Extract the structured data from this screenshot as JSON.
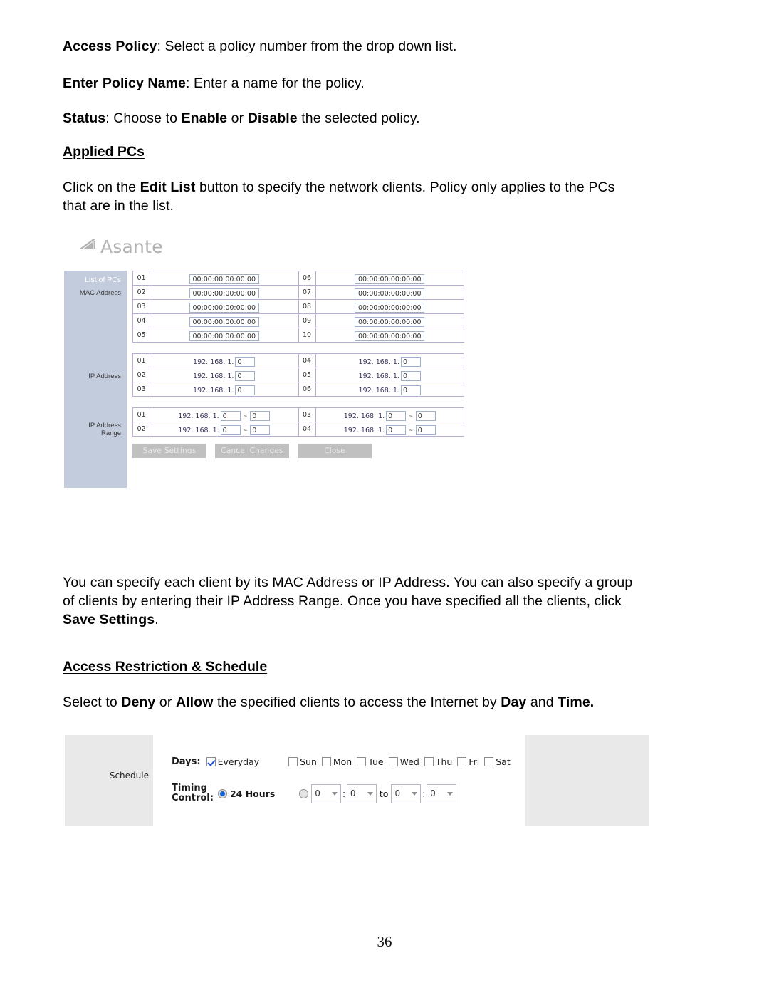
{
  "page": {
    "number": "36"
  },
  "body": {
    "para_access_policy": {
      "term": "Access Policy",
      "rest": ": Select a policy number from the drop down list."
    },
    "para_policy_name": {
      "term": "Enter Policy Name",
      "rest": ": Enter a name for the policy."
    },
    "para_status": {
      "term": "Status",
      "mid": ": Choose to ",
      "enable": "Enable",
      "or": " or ",
      "disable": "Disable",
      "end": " the selected policy."
    },
    "heading_applied_pcs": "Applied PCs",
    "para_edit_list": {
      "pre": "Click on the ",
      "term": "Edit List",
      "rest": " button to specify the network clients. Policy only applies to the PCs that are in the list."
    },
    "para_specify_clients": {
      "pre": "You can specify each client by its MAC Address or IP Address. You can also specify a group of clients by entering their IP Address Range. Once you have specified all the clients, click ",
      "term": "Save Settings",
      "end": "."
    },
    "heading_access_restriction": "Access Restriction & Schedule",
    "para_deny_allow": {
      "pre": "Select to ",
      "deny": "Deny",
      "or": " or ",
      "allow": "Allow",
      "mid": " the specified clients to access the Internet by ",
      "day": "Day",
      "and": " and ",
      "time": "Time."
    }
  },
  "screenshot_pcs": {
    "brand": "Asante",
    "sidebar": {
      "title": "List of PCs",
      "label_mac": "MAC Address",
      "label_ip": "IP Address",
      "label_ip_range": "IP Address Range"
    },
    "mac_table": {
      "left": [
        {
          "index": "01",
          "value": "00:00:00:00:00:00"
        },
        {
          "index": "02",
          "value": "00:00:00:00:00:00"
        },
        {
          "index": "03",
          "value": "00:00:00:00:00:00"
        },
        {
          "index": "04",
          "value": "00:00:00:00:00:00"
        },
        {
          "index": "05",
          "value": "00:00:00:00:00:00"
        }
      ],
      "right": [
        {
          "index": "06",
          "value": "00:00:00:00:00:00"
        },
        {
          "index": "07",
          "value": "00:00:00:00:00:00"
        },
        {
          "index": "08",
          "value": "00:00:00:00:00:00"
        },
        {
          "index": "09",
          "value": "00:00:00:00:00:00"
        },
        {
          "index": "10",
          "value": "00:00:00:00:00:00"
        }
      ]
    },
    "ip_table": {
      "prefix": "192. 168. 1.",
      "left": [
        {
          "index": "01",
          "octet": "0"
        },
        {
          "index": "02",
          "octet": "0"
        },
        {
          "index": "03",
          "octet": "0"
        }
      ],
      "right": [
        {
          "index": "04",
          "octet": "0"
        },
        {
          "index": "05",
          "octet": "0"
        },
        {
          "index": "06",
          "octet": "0"
        }
      ]
    },
    "ip_range_table": {
      "prefix": "192. 168. 1.",
      "separator": "~",
      "left": [
        {
          "index": "01",
          "from": "0",
          "to": "0"
        },
        {
          "index": "02",
          "from": "0",
          "to": "0"
        }
      ],
      "right": [
        {
          "index": "03",
          "from": "0",
          "to": "0"
        },
        {
          "index": "04",
          "from": "0",
          "to": "0"
        }
      ]
    },
    "buttons": {
      "save": "Save Settings",
      "cancel": "Cancel Changes",
      "close": "Close"
    }
  },
  "screenshot_schedule": {
    "panel_label": "Schedule",
    "days_label": "Days:",
    "everyday": {
      "label": "Everyday",
      "checked": true
    },
    "weekdays": [
      {
        "label": "Sun",
        "checked": false
      },
      {
        "label": "Mon",
        "checked": false
      },
      {
        "label": "Tue",
        "checked": false
      },
      {
        "label": "Wed",
        "checked": false
      },
      {
        "label": "Thu",
        "checked": false
      },
      {
        "label": "Fri",
        "checked": false
      },
      {
        "label": "Sat",
        "checked": false
      }
    ],
    "timing_label_line1": "Timing",
    "timing_label_line2": "Control:",
    "radio_24h": {
      "label": "24 Hours",
      "selected": true
    },
    "radio_range": {
      "label": "",
      "selected": false
    },
    "time_from_hour": "0",
    "time_from_min": "0",
    "time_to_hour": "0",
    "time_to_min": "0",
    "colon": ":",
    "to_label": "to"
  },
  "colors": {
    "sidebar_bg": "#c3ccdd",
    "panel_gray": "#e9e9e9",
    "button_gray": "#c0c0c0",
    "grid_border": "#b9aecd",
    "accent_blue": "#1565d8"
  }
}
